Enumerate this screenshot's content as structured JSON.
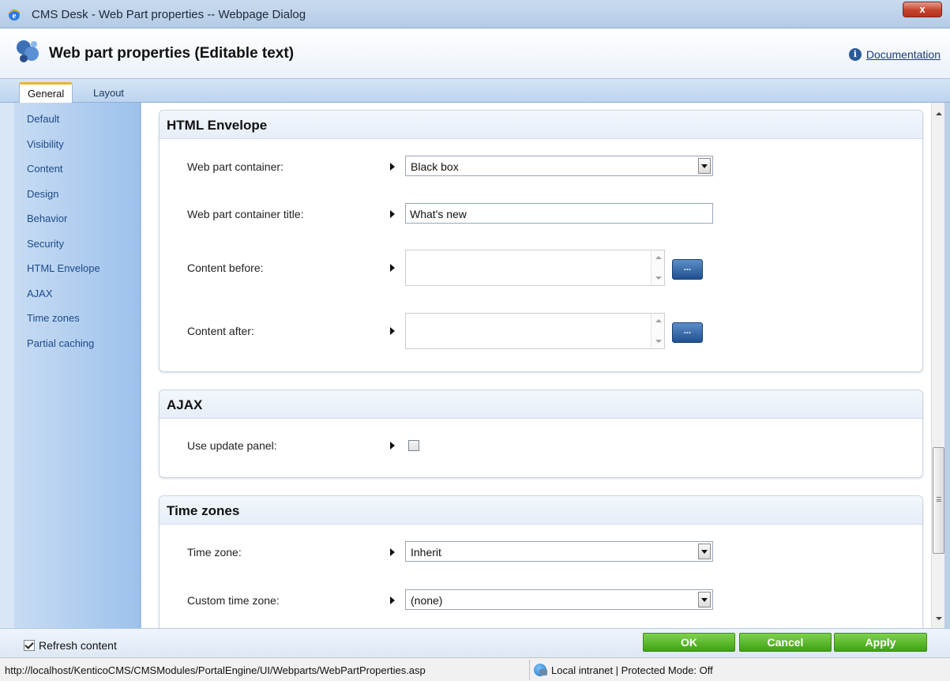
{
  "window": {
    "title": "CMS Desk - Web Part properties -- Webpage Dialog",
    "close_label": "x"
  },
  "header": {
    "title": "Web part properties (Editable text)",
    "documentation_label": "Documentation"
  },
  "tabs": [
    {
      "label": "General",
      "active": true
    },
    {
      "label": "Layout",
      "active": false
    }
  ],
  "sidebar": {
    "items": [
      {
        "label": "Default"
      },
      {
        "label": "Visibility"
      },
      {
        "label": "Content"
      },
      {
        "label": "Design"
      },
      {
        "label": "Behavior"
      },
      {
        "label": "Security"
      },
      {
        "label": "HTML Envelope"
      },
      {
        "label": "AJAX"
      },
      {
        "label": "Time zones"
      },
      {
        "label": "Partial caching"
      }
    ]
  },
  "sections": {
    "html_envelope": {
      "title": "HTML Envelope",
      "container_label": "Web part container:",
      "container_value": "Black box",
      "container_title_label": "Web part container title:",
      "container_title_value": "What's new",
      "content_before_label": "Content before:",
      "content_after_label": "Content after:",
      "dots_label": "..."
    },
    "ajax": {
      "title": "AJAX",
      "update_panel_label": "Use update panel:",
      "update_panel_checked": false
    },
    "time_zones": {
      "title": "Time zones",
      "time_zone_label": "Time zone:",
      "time_zone_value": "Inherit",
      "custom_label": "Custom time zone:",
      "custom_value": "(none)"
    }
  },
  "footer": {
    "refresh_label": "Refresh content",
    "refresh_checked": true,
    "ok_label": "OK",
    "cancel_label": "Cancel",
    "apply_label": "Apply"
  },
  "statusbar": {
    "url": "http://localhost/KenticoCMS/CMSModules/PortalEngine/UI/Webparts/WebPartProperties.asp",
    "zone": "Local intranet | Protected Mode: Off"
  },
  "colors": {
    "accent_green": "#3ea312",
    "link_blue": "#1d4a8a",
    "tab_highlight": "#f2b51f"
  }
}
